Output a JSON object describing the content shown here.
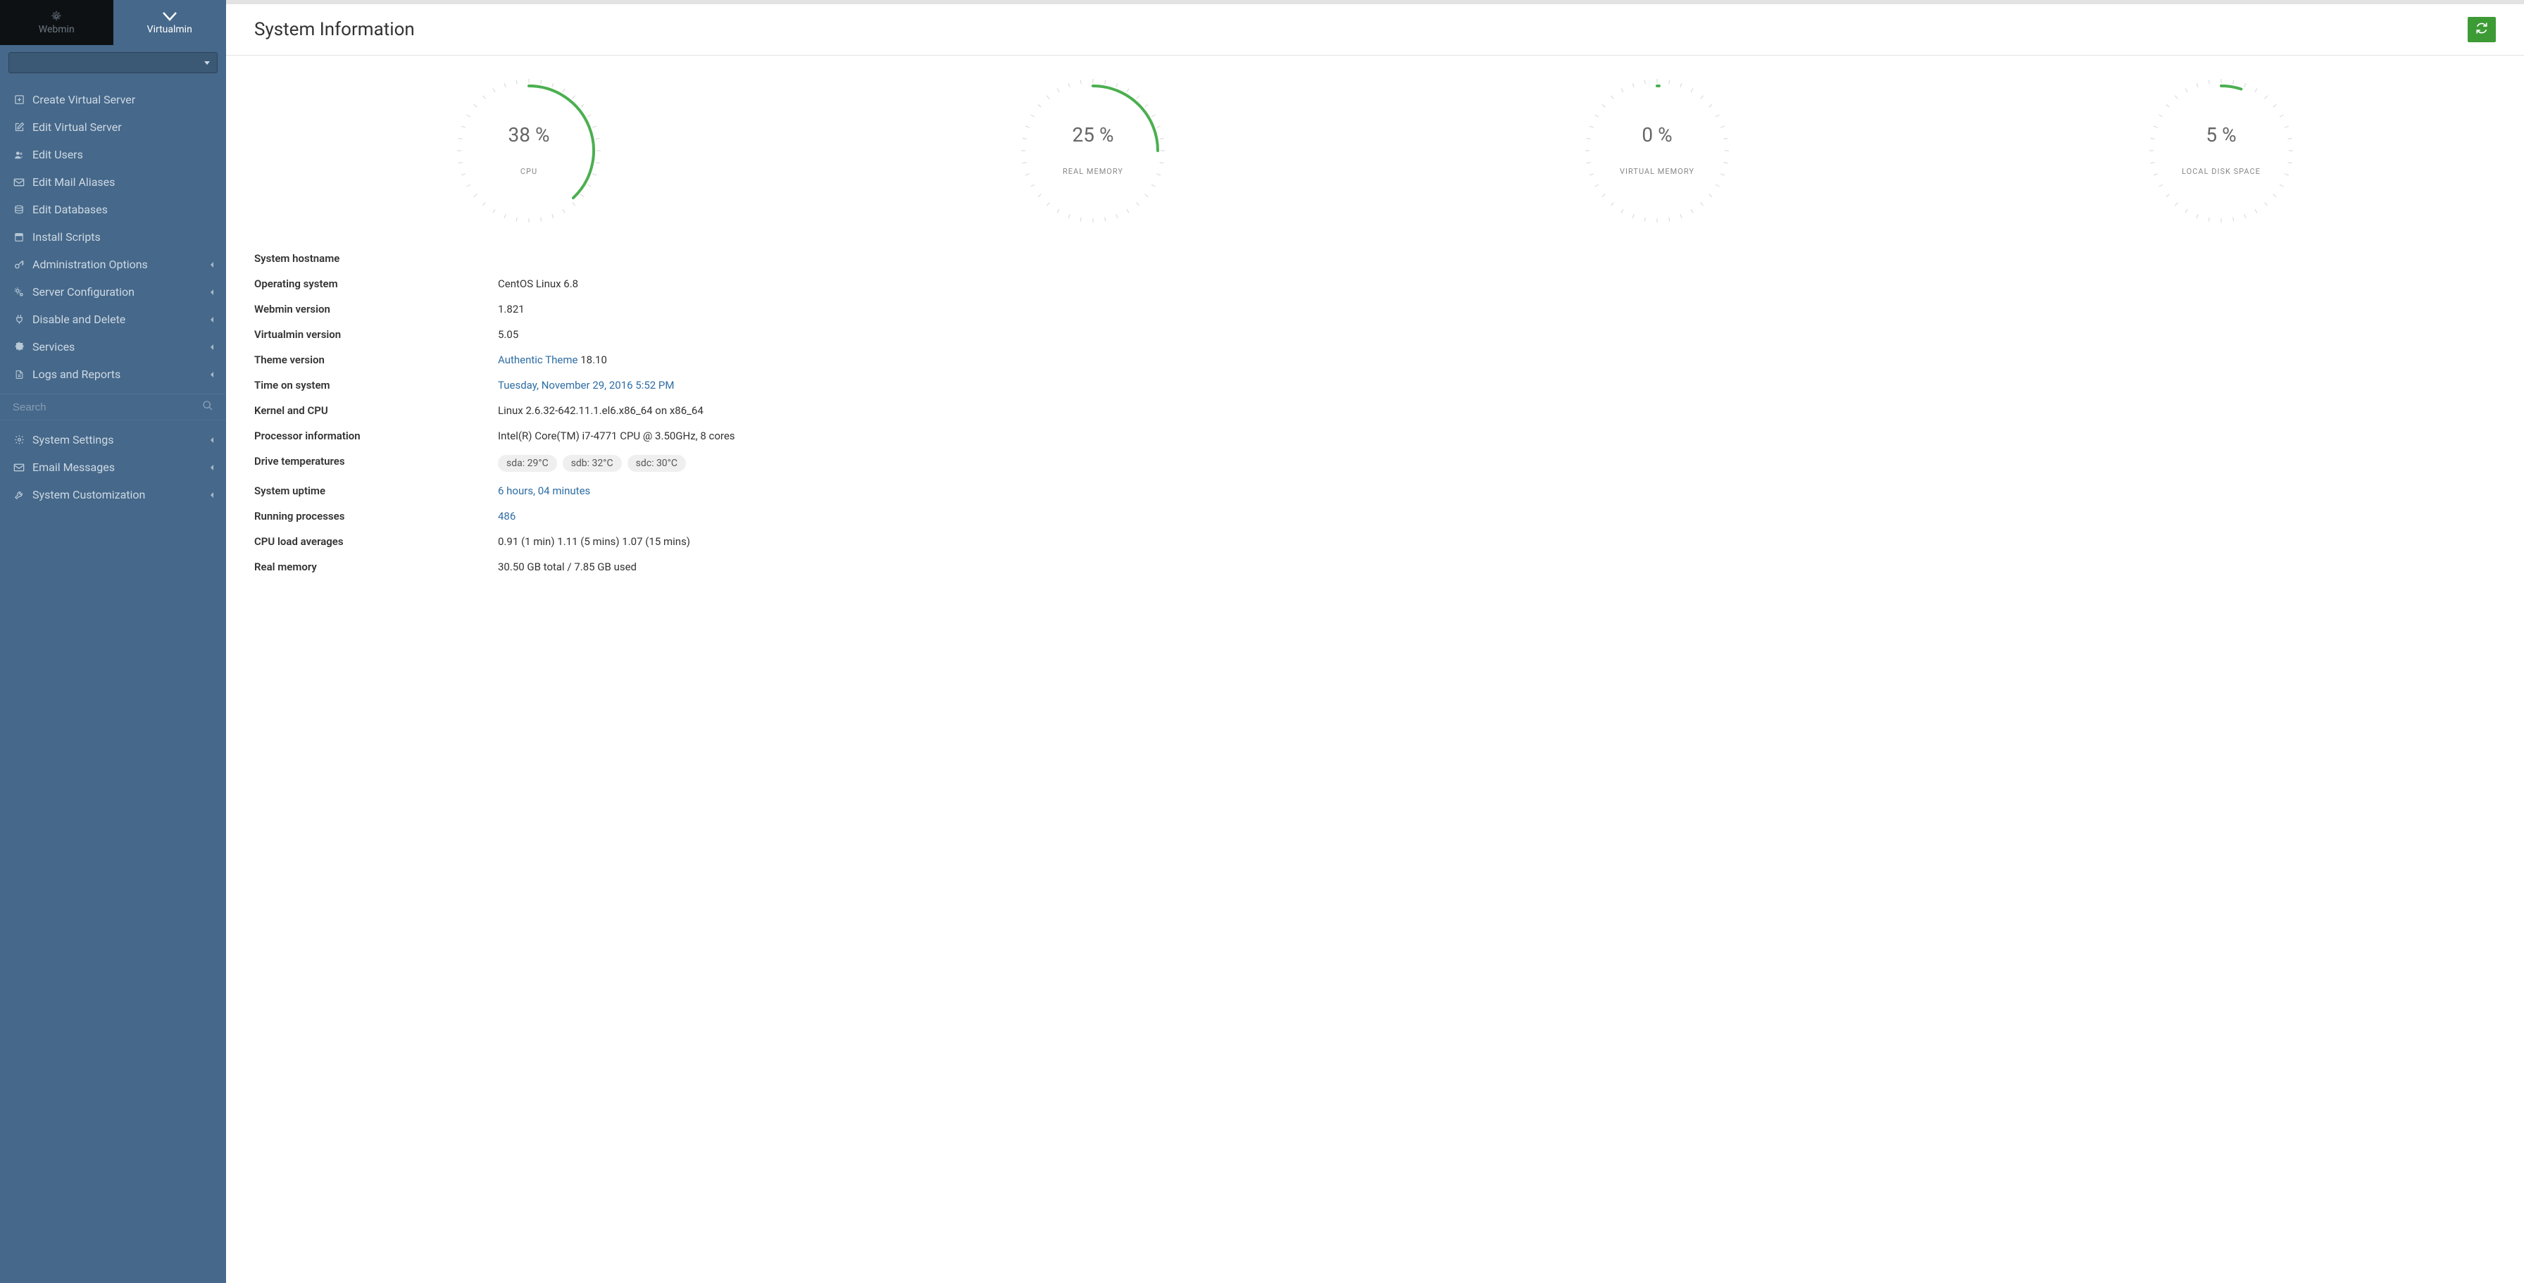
{
  "tabs": {
    "webmin": "Webmin",
    "virtualmin": "Virtualmin"
  },
  "sidebar": {
    "dropdown": "",
    "items": [
      {
        "label": "Create Virtual Server",
        "icon": "plus-square",
        "expandable": false
      },
      {
        "label": "Edit Virtual Server",
        "icon": "edit",
        "expandable": false
      },
      {
        "label": "Edit Users",
        "icon": "users",
        "expandable": false
      },
      {
        "label": "Edit Mail Aliases",
        "icon": "envelope",
        "expandable": false
      },
      {
        "label": "Edit Databases",
        "icon": "database",
        "expandable": false
      },
      {
        "label": "Install Scripts",
        "icon": "window",
        "expandable": false
      },
      {
        "label": "Administration Options",
        "icon": "key",
        "expandable": true
      },
      {
        "label": "Server Configuration",
        "icon": "cogs",
        "expandable": true
      },
      {
        "label": "Disable and Delete",
        "icon": "plug",
        "expandable": true
      },
      {
        "label": "Services",
        "icon": "puzzle",
        "expandable": true
      },
      {
        "label": "Logs and Reports",
        "icon": "file",
        "expandable": true
      }
    ],
    "search_placeholder": "Search",
    "bottom": [
      {
        "label": "System Settings",
        "icon": "gear",
        "expandable": true
      },
      {
        "label": "Email Messages",
        "icon": "envelope",
        "expandable": true
      },
      {
        "label": "System Customization",
        "icon": "wrench",
        "expandable": true
      }
    ]
  },
  "header": {
    "title": "System Information"
  },
  "chart_data": {
    "type": "gauge",
    "gauges": [
      {
        "label": "CPU",
        "value": 38,
        "display": "38 %"
      },
      {
        "label": "REAL MEMORY",
        "value": 25,
        "display": "25 %"
      },
      {
        "label": "VIRTUAL MEMORY",
        "value": 0,
        "display": "0 %"
      },
      {
        "label": "LOCAL DISK SPACE",
        "value": 5,
        "display": "5 %"
      }
    ],
    "range": [
      0,
      100
    ],
    "arc_color": "#4caf50"
  },
  "info": [
    {
      "key": "System hostname",
      "value": ""
    },
    {
      "key": "Operating system",
      "value": "CentOS Linux 6.8"
    },
    {
      "key": "Webmin version",
      "value": "1.821"
    },
    {
      "key": "Virtualmin version",
      "value": "5.05"
    },
    {
      "key": "Theme version",
      "link": "Authentic Theme",
      "after": " 18.10"
    },
    {
      "key": "Time on system",
      "link": "Tuesday, November 29, 2016 5:52 PM"
    },
    {
      "key": "Kernel and CPU",
      "value": "Linux 2.6.32-642.11.1.el6.x86_64 on x86_64"
    },
    {
      "key": "Processor information",
      "value": "Intel(R) Core(TM) i7-4771 CPU @ 3.50GHz, 8 cores"
    },
    {
      "key": "Drive temperatures",
      "badges": [
        "sda: 29°C",
        "sdb: 32°C",
        "sdc: 30°C"
      ]
    },
    {
      "key": "System uptime",
      "link": "6 hours, 04 minutes"
    },
    {
      "key": "Running processes",
      "link": "486"
    },
    {
      "key": "CPU load averages",
      "value": "0.91 (1 min) 1.11 (5 mins) 1.07 (15 mins)"
    },
    {
      "key": "Real memory",
      "value": "30.50 GB total / 7.85 GB used"
    }
  ]
}
